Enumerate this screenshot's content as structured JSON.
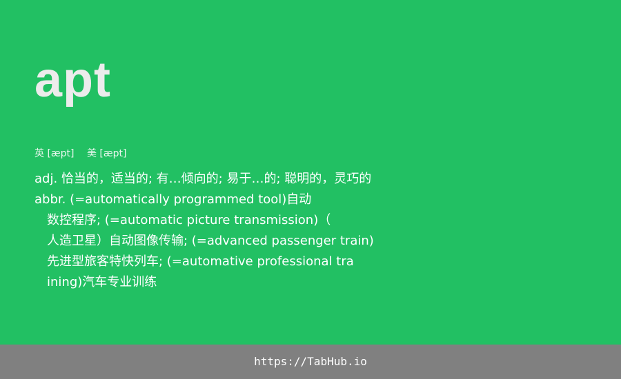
{
  "word": "apt",
  "phonetics": {
    "uk": "英 [æpt]",
    "us": "美 [æpt]"
  },
  "definitions": [
    "adj. 恰当的，适当的; 有…倾向的; 易于…的; 聪明的，灵巧的",
    "abbr. (=automatically programmed tool)自动",
    "数控程序; (=automatic picture transmission)（",
    "人造卫星）自动图像传输; (=advanced passenger train)",
    "先进型旅客特快列车; (=automative professional tra",
    "ining)汽车专业训练"
  ],
  "footer": {
    "url": "https://TabHub.io"
  },
  "colors": {
    "background": "#22c063",
    "footer": "#808080",
    "word": "#ececec",
    "text": "#ffffff"
  }
}
